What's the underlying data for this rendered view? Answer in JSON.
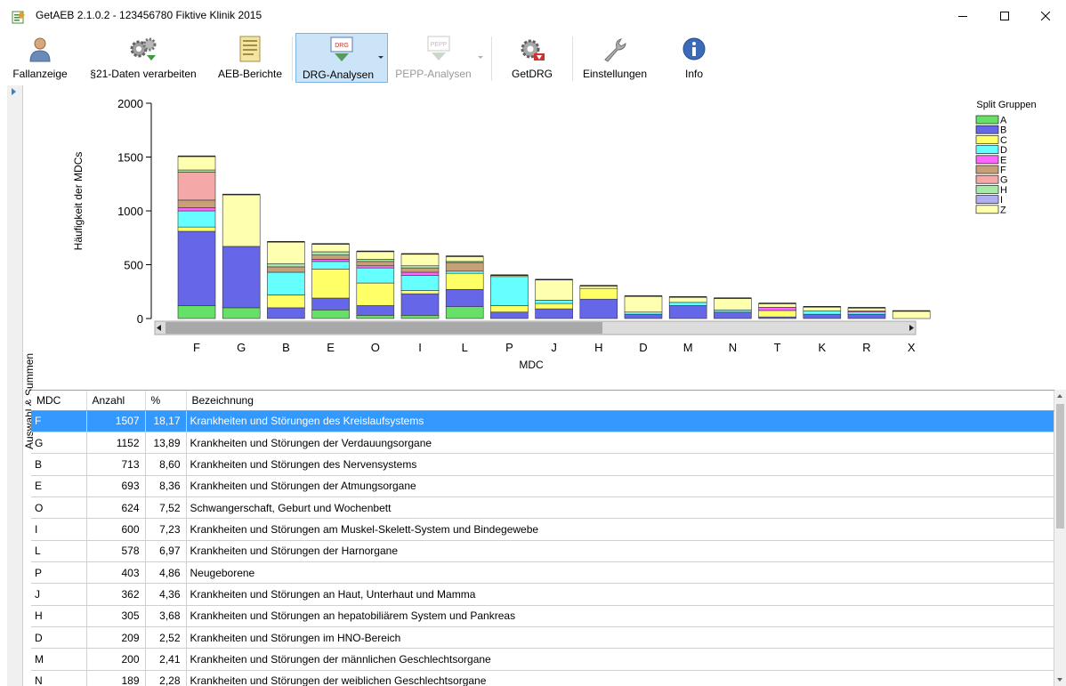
{
  "window": {
    "title": "GetAEB 2.1.0.2 - 123456780 Fiktive Klinik 2015"
  },
  "toolbar": {
    "items": [
      {
        "label": "Fallanzeige",
        "icon": "person-icon"
      },
      {
        "label": "§21-Daten verarbeiten",
        "icon": "gears-icon"
      },
      {
        "label": "AEB-Berichte",
        "icon": "report-icon"
      },
      {
        "label": "DRG-Analysen",
        "icon": "drg-icon"
      },
      {
        "label": "PEPP-Analysen",
        "icon": "pepp-icon"
      },
      {
        "label": "GetDRG",
        "icon": "getdrg-icon"
      },
      {
        "label": "Einstellungen",
        "icon": "wrench-icon"
      },
      {
        "label": "Info",
        "icon": "info-icon"
      }
    ]
  },
  "side_panel": {
    "label": "Auswahl & Summen"
  },
  "colors": {
    "selection": "#3399ff",
    "A": "#66e066",
    "B": "#6666e8",
    "C": "#ffff66",
    "D": "#66ffff",
    "E": "#ff66ff",
    "F": "#c8a078",
    "G": "#f4a8a8",
    "H": "#a8e8a8",
    "I": "#b0b0f0",
    "Z": "#ffffb0"
  },
  "chart_data": {
    "type": "bar",
    "stacked": true,
    "xlabel": "MDC",
    "ylabel": "Häufigkeit der MDCs",
    "ylim": [
      0,
      2000
    ],
    "yticks": [
      "0",
      "500",
      "1000",
      "1500",
      "2000"
    ],
    "legend_title": "Split Gruppen",
    "legend_position": "top-right",
    "categories": [
      "F",
      "G",
      "B",
      "E",
      "O",
      "I",
      "L",
      "P",
      "J",
      "H",
      "D",
      "M",
      "N",
      "T",
      "K",
      "R",
      "X"
    ],
    "series": [
      {
        "name": "A",
        "values": [
          120,
          100,
          0,
          80,
          30,
          30,
          110,
          0,
          0,
          0,
          0,
          0,
          0,
          0,
          0,
          0,
          0
        ]
      },
      {
        "name": "B",
        "values": [
          690,
          570,
          100,
          110,
          90,
          200,
          160,
          60,
          90,
          180,
          40,
          120,
          60,
          15,
          40,
          40,
          0
        ]
      },
      {
        "name": "C",
        "values": [
          40,
          0,
          120,
          270,
          210,
          30,
          150,
          60,
          50,
          100,
          0,
          0,
          0,
          60,
          0,
          0,
          0
        ]
      },
      {
        "name": "D",
        "values": [
          150,
          0,
          210,
          70,
          140,
          140,
          20,
          270,
          30,
          0,
          20,
          30,
          20,
          0,
          30,
          20,
          0
        ]
      },
      {
        "name": "E",
        "values": [
          30,
          0,
          0,
          20,
          20,
          30,
          0,
          0,
          0,
          0,
          0,
          0,
          0,
          30,
          0,
          10,
          0
        ]
      },
      {
        "name": "F",
        "values": [
          70,
          0,
          50,
          40,
          40,
          40,
          80,
          0,
          0,
          0,
          0,
          0,
          0,
          0,
          0,
          0,
          0
        ]
      },
      {
        "name": "G",
        "values": [
          260,
          0,
          0,
          0,
          0,
          0,
          0,
          0,
          0,
          0,
          0,
          0,
          0,
          0,
          0,
          0,
          0
        ]
      },
      {
        "name": "H",
        "values": [
          20,
          0,
          30,
          30,
          20,
          20,
          10,
          0,
          0,
          0,
          0,
          0,
          0,
          0,
          0,
          0,
          0
        ]
      },
      {
        "name": "I",
        "values": [
          0,
          0,
          0,
          0,
          0,
          0,
          0,
          0,
          0,
          0,
          0,
          0,
          0,
          0,
          0,
          0,
          0
        ]
      },
      {
        "name": "Z",
        "values": [
          127,
          482,
          203,
          73,
          74,
          110,
          48,
          13,
          192,
          25,
          149,
          50,
          109,
          35,
          40,
          30,
          70
        ]
      }
    ]
  },
  "table": {
    "columns": [
      "MDC",
      "Anzahl",
      "%",
      "Bezeichnung"
    ],
    "selected_row": 0,
    "rows": [
      {
        "mdc": "F",
        "anzahl": "1507",
        "pct": "18,17",
        "bez": "Krankheiten und Störungen des Kreislaufsystems"
      },
      {
        "mdc": "G",
        "anzahl": "1152",
        "pct": "13,89",
        "bez": "Krankheiten und Störungen der Verdauungsorgane"
      },
      {
        "mdc": "B",
        "anzahl": "713",
        "pct": "8,60",
        "bez": "Krankheiten und Störungen des Nervensystems"
      },
      {
        "mdc": "E",
        "anzahl": "693",
        "pct": "8,36",
        "bez": "Krankheiten und Störungen der Atmungsorgane"
      },
      {
        "mdc": "O",
        "anzahl": "624",
        "pct": "7,52",
        "bez": "Schwangerschaft, Geburt und Wochenbett"
      },
      {
        "mdc": "I",
        "anzahl": "600",
        "pct": "7,23",
        "bez": "Krankheiten und Störungen am Muskel-Skelett-System und Bindegewebe"
      },
      {
        "mdc": "L",
        "anzahl": "578",
        "pct": "6,97",
        "bez": "Krankheiten und Störungen der Harnorgane"
      },
      {
        "mdc": "P",
        "anzahl": "403",
        "pct": "4,86",
        "bez": "Neugeborene"
      },
      {
        "mdc": "J",
        "anzahl": "362",
        "pct": "4,36",
        "bez": "Krankheiten und Störungen an Haut, Unterhaut und Mamma"
      },
      {
        "mdc": "H",
        "anzahl": "305",
        "pct": "3,68",
        "bez": "Krankheiten und Störungen an hepatobiliärem System und Pankreas"
      },
      {
        "mdc": "D",
        "anzahl": "209",
        "pct": "2,52",
        "bez": "Krankheiten und Störungen im HNO-Bereich"
      },
      {
        "mdc": "M",
        "anzahl": "200",
        "pct": "2,41",
        "bez": "Krankheiten und Störungen der männlichen Geschlechtsorgane"
      },
      {
        "mdc": "N",
        "anzahl": "189",
        "pct": "2,28",
        "bez": "Krankheiten und Störungen der weiblichen Geschlechtsorgane"
      }
    ]
  }
}
